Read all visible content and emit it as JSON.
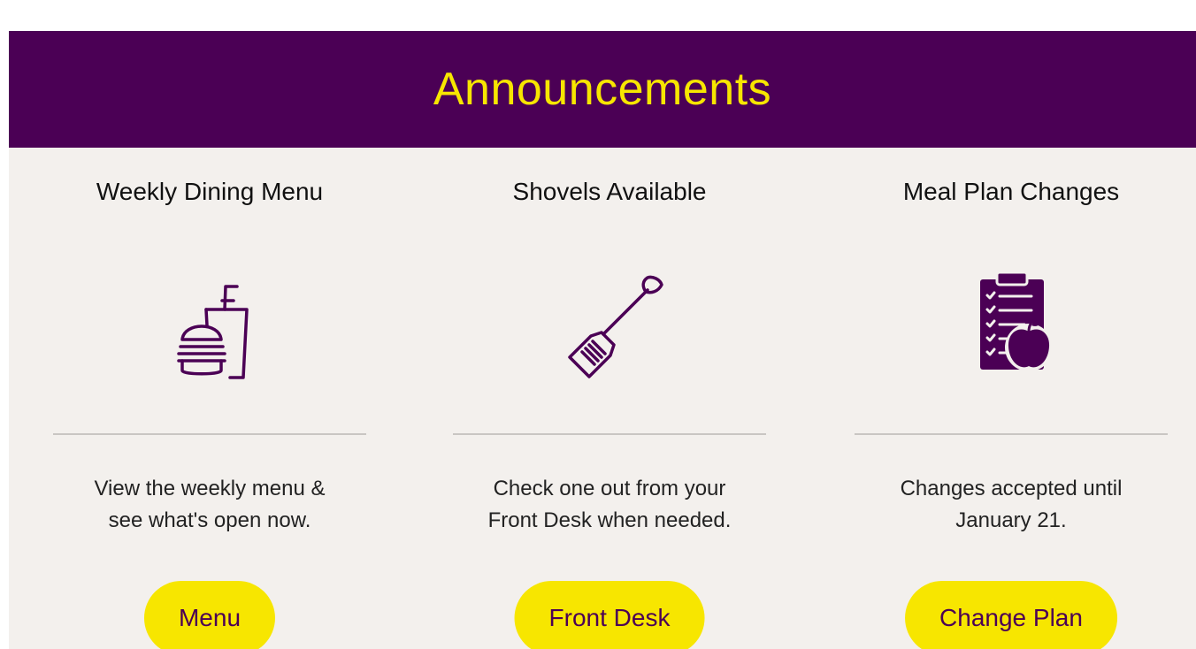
{
  "banner": {
    "title": "Announcements"
  },
  "colors": {
    "brand_purple": "#4b0055",
    "accent_yellow": "#f7e600",
    "background": "#f3f0ed"
  },
  "cards": [
    {
      "title": "Weekly Dining Menu",
      "icon": "dining-tray-icon",
      "text_line1": "View the weekly menu &",
      "text_line2": "see what's open now.",
      "button": "Menu"
    },
    {
      "title": "Shovels Available",
      "icon": "shovel-icon",
      "text_line1": "Check one out from your",
      "text_line2": "Front Desk when needed.",
      "button": "Front Desk"
    },
    {
      "title": "Meal Plan Changes",
      "icon": "clipboard-apple-icon",
      "text_line1": "Changes accepted until",
      "text_line2": "January 21.",
      "button": "Change Plan"
    }
  ]
}
